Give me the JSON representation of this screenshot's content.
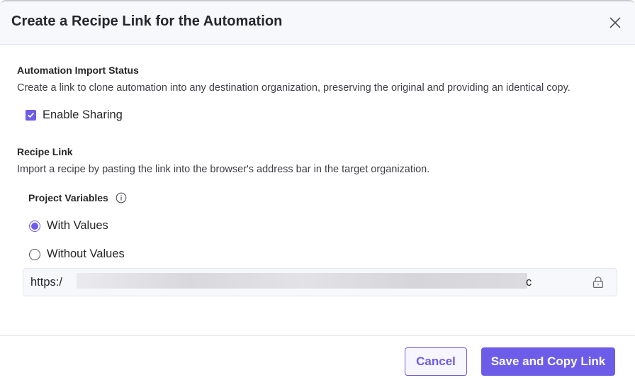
{
  "dialog": {
    "title": "Create a Recipe Link for the Automation",
    "close_label": "Close"
  },
  "import_status": {
    "title": "Automation Import Status",
    "description": "Create a link to clone automation into any destination organization, preserving the original and providing an identical copy.",
    "enable_sharing": {
      "label": "Enable Sharing",
      "checked": true
    }
  },
  "recipe_link": {
    "title": "Recipe Link",
    "description": "Import a recipe by pasting the link into the browser's address bar in the target organization.",
    "project_variables": {
      "label": "Project Variables",
      "info_icon": "info-icon",
      "options": [
        {
          "label": "With Values",
          "selected": true
        },
        {
          "label": "Without Values",
          "selected": false
        }
      ]
    },
    "link": {
      "prefix": "https:/",
      "suffix": "c",
      "redacted": true,
      "icon": "lock-icon"
    }
  },
  "footer": {
    "cancel_label": "Cancel",
    "primary_label": "Save and Copy Link"
  },
  "colors": {
    "accent": "#6c5ce7",
    "header_bg": "#f7f8fc",
    "border": "#e3e6ee"
  }
}
